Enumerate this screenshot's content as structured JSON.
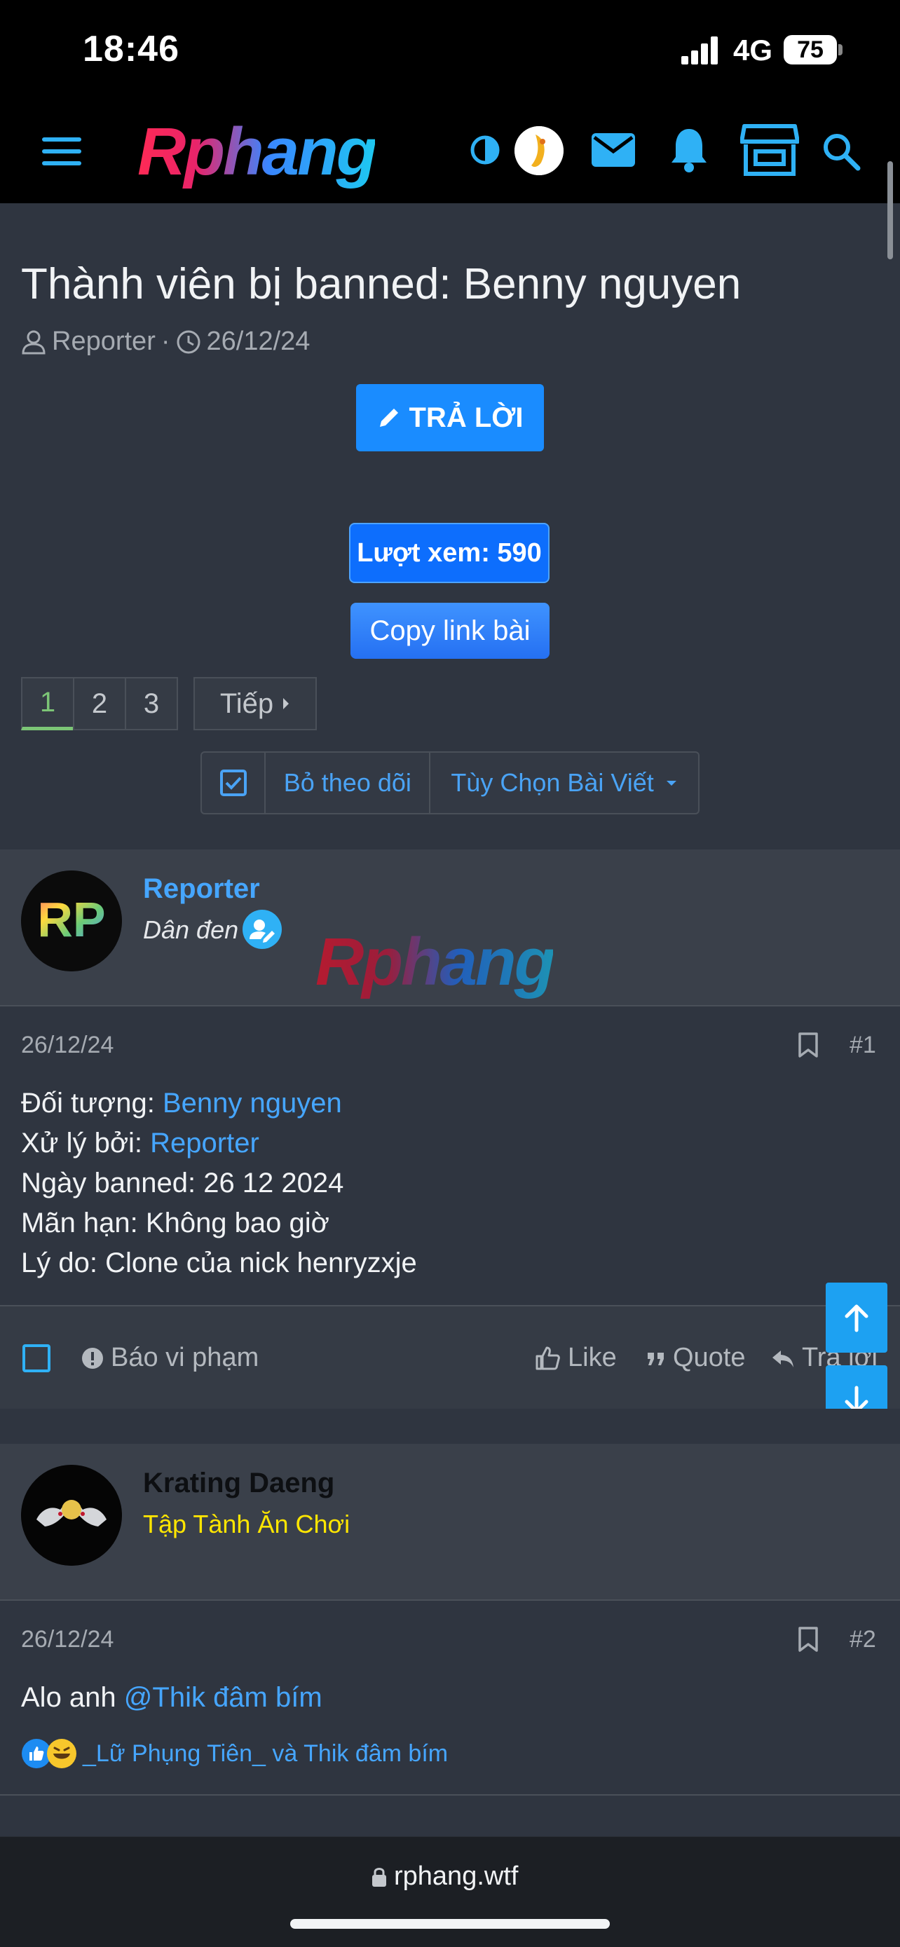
{
  "status_bar": {
    "time": "18:46",
    "network": "4G",
    "battery": "75"
  },
  "header": {
    "logo": "Rphang"
  },
  "thread": {
    "title": "Thành viên bị banned: Benny nguyen",
    "author": "Reporter",
    "date": "26/12/24",
    "reply_button": "TRẢ LỜI",
    "views_label": "Lượt xem: 590",
    "copy_link": "Copy link bài"
  },
  "pager": {
    "pages": [
      "1",
      "2",
      "3"
    ],
    "current": "1",
    "next": "Tiếp"
  },
  "actions": {
    "unfollow": "Bỏ theo dõi",
    "options": "Tùy Chọn Bài Viết"
  },
  "posts": [
    {
      "username": "Reporter",
      "user_title": "Dân đen",
      "avatar_text": "RP",
      "date": "26/12/24",
      "number": "#1",
      "lines": [
        {
          "label": "Đối tượng: ",
          "value": "Benny nguyen"
        },
        {
          "label": "Xử lý bởi: ",
          "value": "Reporter"
        },
        {
          "label": "Ngày banned: 26 12 2024",
          "value": ""
        },
        {
          "label": "Mãn hạn: Không bao giờ",
          "value": ""
        },
        {
          "label": "Lý do: Clone của nick henryzxje",
          "value": ""
        }
      ],
      "footer": {
        "report": "Báo vi phạm",
        "like": "Like",
        "quote": "Quote",
        "reply": "Trả lời"
      }
    },
    {
      "username": "Krating Daeng",
      "user_title": "Tập Tành Ăn Chơi",
      "date": "26/12/24",
      "number": "#2",
      "text_prefix": "Alo anh ",
      "mention": "@Thik đâm bím",
      "reactions": "_Lữ Phụng Tiên_ và Thik đâm bím"
    }
  ],
  "watermark": "Rphang",
  "browser": {
    "url": "rphang.wtf"
  },
  "colors": {
    "accent": "#1a8cff",
    "link": "#46a6ff",
    "user_title_2": "#ffe600",
    "page_current": "#7cc576"
  }
}
